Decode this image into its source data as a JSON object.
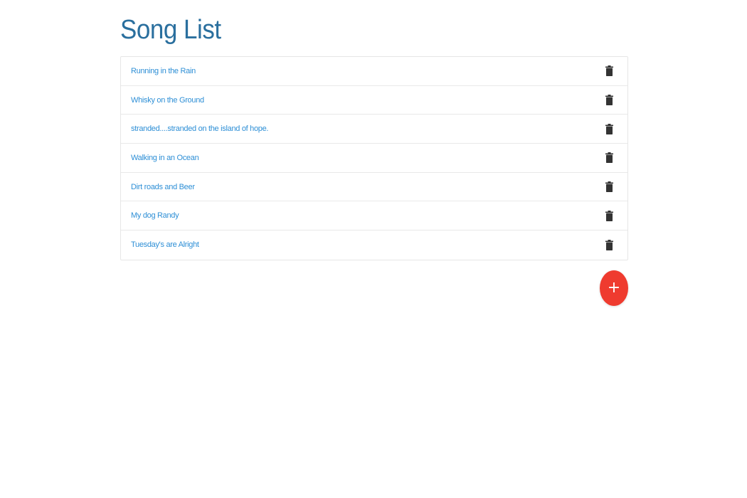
{
  "header": {
    "title": "Song List"
  },
  "songs": [
    {
      "title": "Running in the Rain",
      "action_icon": "trash-icon"
    },
    {
      "title": "Whisky on the Ground",
      "action_icon": "trash-icon"
    },
    {
      "title": "stranded....stranded on the island of hope.",
      "action_icon": "trash-icon"
    },
    {
      "title": "Walking in an Ocean",
      "action_icon": "trash-icon"
    },
    {
      "title": "Dirt roads and Beer",
      "action_icon": "trash-icon"
    },
    {
      "title": "My dog Randy",
      "action_icon": "trash-icon"
    },
    {
      "title": "Tuesday's are Alright",
      "action_icon": "trash-icon"
    }
  ],
  "fab": {
    "label": "+",
    "icon": "plus-icon"
  },
  "colors": {
    "title": "#2a6f9e",
    "link": "#2e8fd6",
    "fab": "#ef3b2f",
    "icon": "#333333"
  }
}
